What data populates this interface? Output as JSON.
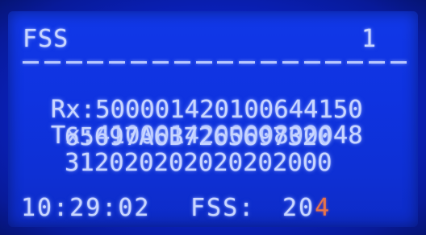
{
  "screen": {
    "title": "FSS",
    "page_number": "1",
    "rx_label": "Rx:",
    "rx_value": "500001420100644150",
    "tx_label": "Tx:",
    "tx_line1": "410001420000800048",
    "tx_line2": "65697A6B7265697320",
    "tx_line3": "312020202020202000",
    "time": "10:29:02",
    "status_label": "FSS:",
    "status_value_head": "20",
    "status_value_tail": "4"
  },
  "colors": {
    "background": "#0f33e0",
    "text": "#c9d6ff",
    "highlight": "#e6734a"
  }
}
